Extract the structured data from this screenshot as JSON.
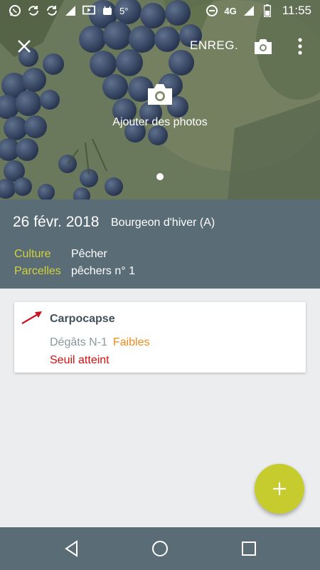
{
  "status_bar": {
    "temperature": "5°",
    "network": "4G",
    "time": "11:55",
    "icons": [
      "whatsapp-icon",
      "sync-icon",
      "sync-icon",
      "wifi-calling-icon",
      "cast-icon",
      "android-icon",
      "do-not-disturb-icon",
      "signal-icon",
      "battery-icon"
    ]
  },
  "toolbar": {
    "save_label": "ENREG.",
    "icons": [
      "close-icon",
      "camera-icon",
      "more-vert-icon"
    ]
  },
  "hero": {
    "add_photos_label": "Ajouter des photos"
  },
  "observation": {
    "date": "26 févr. 2018",
    "stage": "Bourgeon d'hiver (A)",
    "culture_label": "Culture",
    "culture_value": "Pêcher",
    "parcelles_label": "Parcelles",
    "parcelles_value": "pêchers n° 1"
  },
  "card": {
    "title": "Carpocapse",
    "damage_label": "Dégâts N-1",
    "damage_value": "Faibles",
    "threshold_text": "Seuil atteint"
  },
  "colors": {
    "band": "#5a6c76",
    "accent_yellow": "#d2d23a",
    "fab": "#c6cc2d",
    "orange": "#f08c1a",
    "red": "#d40f0f"
  }
}
